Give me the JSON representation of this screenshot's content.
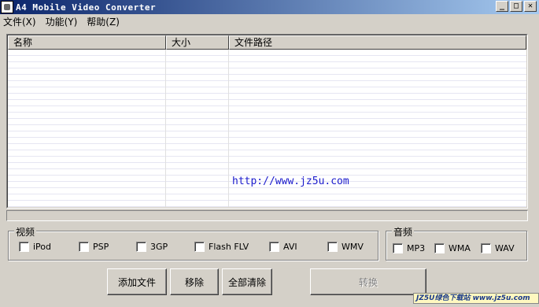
{
  "window": {
    "title": "A4 Mobile Video Converter",
    "buttons": {
      "minimize": "_",
      "maximize": "□",
      "close": "✕"
    }
  },
  "menu": {
    "items": [
      {
        "label": "文件(X)"
      },
      {
        "label": "功能(Y)"
      },
      {
        "label": "帮助(Z)"
      }
    ]
  },
  "file_list": {
    "columns": [
      "名称",
      "大小",
      "文件路径"
    ],
    "rows": []
  },
  "watermark": "http://www.jz5u.com",
  "progress": {
    "value": 0
  },
  "video_group": {
    "title": "视频",
    "options": [
      {
        "label": "iPod",
        "checked": false
      },
      {
        "label": "PSP",
        "checked": false
      },
      {
        "label": "3GP",
        "checked": false
      },
      {
        "label": "Flash FLV",
        "checked": false
      },
      {
        "label": "AVI",
        "checked": false
      },
      {
        "label": "WMV",
        "checked": false
      }
    ]
  },
  "audio_group": {
    "title": "音频",
    "options": [
      {
        "label": "MP3",
        "checked": false
      },
      {
        "label": "WMA",
        "checked": false
      },
      {
        "label": "WAV",
        "checked": false
      }
    ]
  },
  "actions": {
    "add_file": "添加文件",
    "remove": "移除",
    "clear_all": "全部清除",
    "convert": "转换"
  },
  "corner_badge": "JZ5U绿色下载站 www.jz5u.com"
}
